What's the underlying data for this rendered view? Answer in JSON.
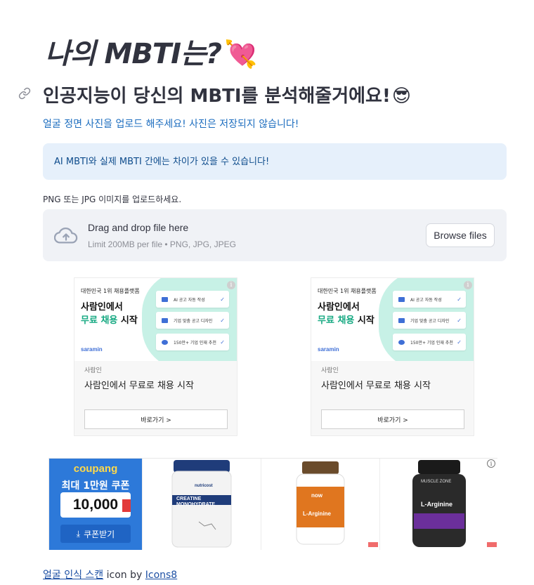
{
  "header": {
    "title": "나의 MBTI는?",
    "title_emoji": "💘",
    "subtitle": "인공지능이 당신의 MBTI를 분석해줄거에요!",
    "subtitle_emoji": "😎",
    "description": "얼굴 정면 사진을 업로드 해주세요! 사진은 저장되지 않습니다!"
  },
  "info_box": {
    "text": "AI MBTI와 실제 MBTI 간에는 차이가 있을 수 있습니다!"
  },
  "uploader": {
    "label": "PNG 또는 JPG 이미지를 업로드하세요.",
    "drop_text": "Drag and drop file here",
    "limit_text": "Limit 200MB per file • PNG, JPG, JPEG",
    "browse_label": "Browse files"
  },
  "ads": [
    {
      "small": "대한민국 1위 채용플랫폼",
      "headline1": "사람인에서",
      "headline2_hl": "무료 채용",
      "headline2_rest": " 시작",
      "brand": "saramin",
      "cards": [
        "AI 공고 자동 작성",
        "기업 맞춤 공고 디자인",
        "150만+ 기업 인재 추천"
      ],
      "advertiser": "사람인",
      "title": "사람인에서 무료로 채용 시작",
      "cta": "바로가기 >"
    },
    {
      "small": "대한민국 1위 채용플랫폼",
      "headline1": "사람인에서",
      "headline2_hl": "무료 채용",
      "headline2_rest": " 시작",
      "brand": "saramin",
      "cards": [
        "AI 공고 자동 작성",
        "기업 맞춤 공고 디자인",
        "150만+ 기업 인재 추천"
      ],
      "advertiser": "사람인",
      "title": "사람인에서 무료로 채용 시작",
      "cta": "바로가기 >"
    }
  ],
  "coupang": {
    "logo": "coupang",
    "offer": "최대 1만원 쿠폰",
    "amount": "10,000",
    "button": "쿠폰받기",
    "products": [
      {
        "brand": "nutricost",
        "name": "CREATINE MONOHYDRATE",
        "color": "#1f3c7a"
      },
      {
        "brand": "now",
        "name": "L-Arginine",
        "color": "#e0761f"
      },
      {
        "brand": "MUSCLE ZONE",
        "name": "L-Arginine",
        "color": "#2a2a2a"
      }
    ]
  },
  "footer": {
    "link1": "얼굴 인식 스캔",
    "middle": " icon by ",
    "link2": "Icons8"
  }
}
